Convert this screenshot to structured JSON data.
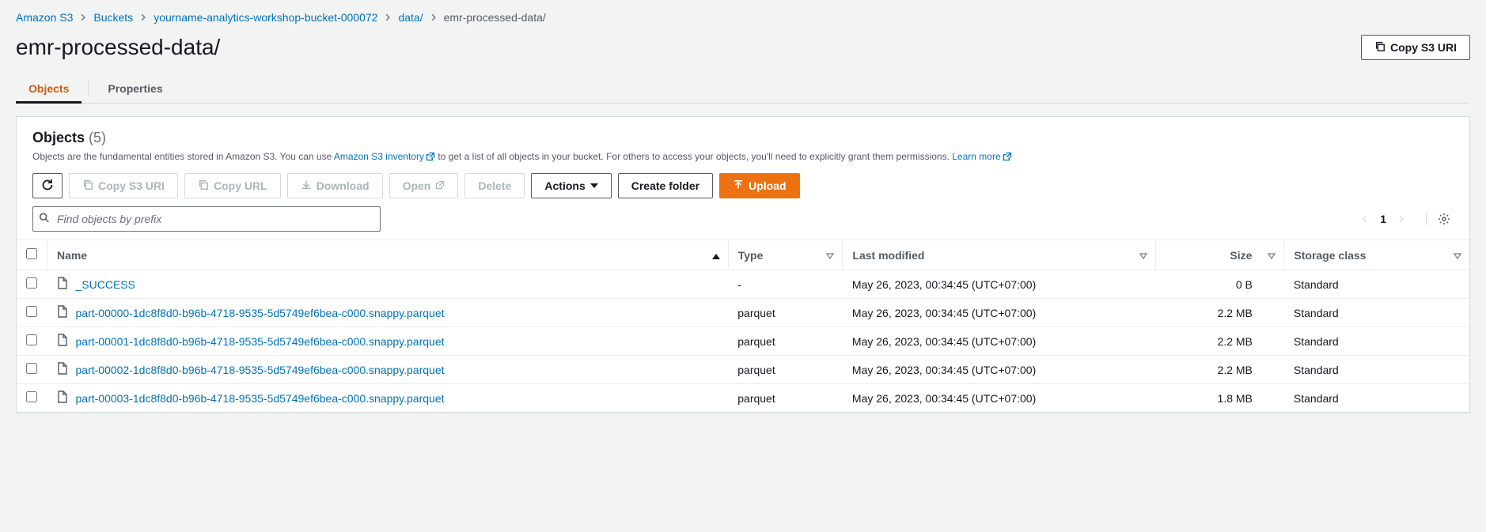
{
  "breadcrumb": [
    {
      "label": "Amazon S3",
      "link": true
    },
    {
      "label": "Buckets",
      "link": true
    },
    {
      "label": "yourname-analytics-workshop-bucket-000072",
      "link": true
    },
    {
      "label": "data/",
      "link": true
    },
    {
      "label": "emr-processed-data/",
      "link": false
    }
  ],
  "page_title": "emr-processed-data/",
  "header_button": "Copy S3 URI",
  "tabs": {
    "objects": "Objects",
    "properties": "Properties"
  },
  "panel": {
    "title": "Objects",
    "count": "(5)",
    "desc_pre": "Objects are the fundamental entities stored in Amazon S3. You can use ",
    "desc_link1": "Amazon S3 inventory",
    "desc_mid": " to get a list of all objects in your bucket. For others to access your objects, you'll need to explicitly grant them permissions. ",
    "desc_link2": "Learn more"
  },
  "toolbar": {
    "copy_s3_uri": "Copy S3 URI",
    "copy_url": "Copy URL",
    "download": "Download",
    "open": "Open",
    "delete": "Delete",
    "actions": "Actions",
    "create_folder": "Create folder",
    "upload": "Upload"
  },
  "search": {
    "placeholder": "Find objects by prefix"
  },
  "pagination": {
    "page": "1"
  },
  "columns": {
    "name": "Name",
    "type": "Type",
    "last_modified": "Last modified",
    "size": "Size",
    "storage_class": "Storage class"
  },
  "rows": [
    {
      "name": "_SUCCESS",
      "type": "-",
      "modified": "May 26, 2023, 00:34:45 (UTC+07:00)",
      "size": "0 B",
      "storage": "Standard"
    },
    {
      "name": "part-00000-1dc8f8d0-b96b-4718-9535-5d5749ef6bea-c000.snappy.parquet",
      "type": "parquet",
      "modified": "May 26, 2023, 00:34:45 (UTC+07:00)",
      "size": "2.2 MB",
      "storage": "Standard"
    },
    {
      "name": "part-00001-1dc8f8d0-b96b-4718-9535-5d5749ef6bea-c000.snappy.parquet",
      "type": "parquet",
      "modified": "May 26, 2023, 00:34:45 (UTC+07:00)",
      "size": "2.2 MB",
      "storage": "Standard"
    },
    {
      "name": "part-00002-1dc8f8d0-b96b-4718-9535-5d5749ef6bea-c000.snappy.parquet",
      "type": "parquet",
      "modified": "May 26, 2023, 00:34:45 (UTC+07:00)",
      "size": "2.2 MB",
      "storage": "Standard"
    },
    {
      "name": "part-00003-1dc8f8d0-b96b-4718-9535-5d5749ef6bea-c000.snappy.parquet",
      "type": "parquet",
      "modified": "May 26, 2023, 00:34:45 (UTC+07:00)",
      "size": "1.8 MB",
      "storage": "Standard"
    }
  ]
}
